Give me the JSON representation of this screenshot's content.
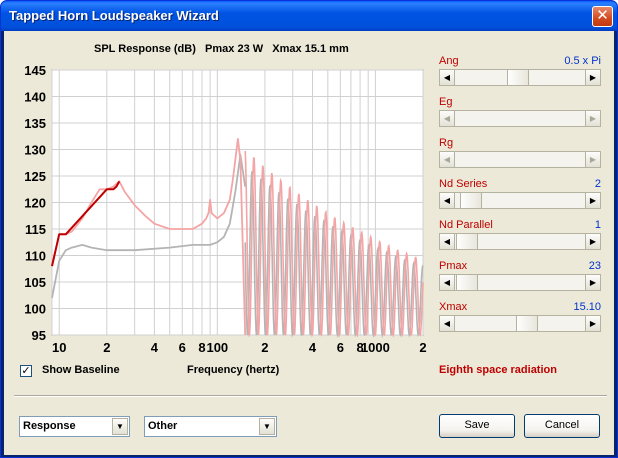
{
  "window": {
    "title": "Tapped Horn Loudspeaker Wizard",
    "close_glyph": "✕"
  },
  "chart": {
    "title": "SPL Response (dB)   Pmax 23 W   Xmax 15.1 mm"
  },
  "chart_data": {
    "type": "line",
    "title": "SPL Response (dB)   Pmax 23 W   Xmax 15.1 mm",
    "xlabel": "Frequency (hertz)",
    "ylabel": "",
    "x_scale": "log",
    "xlim": [
      9,
      2000
    ],
    "ylim": [
      95,
      145
    ],
    "grid": true,
    "x_tick_values": [
      10,
      20,
      40,
      60,
      80,
      100,
      200,
      400,
      600,
      800,
      1000,
      2000
    ],
    "x_tick_labels": [
      "10",
      "2",
      "4",
      "6",
      "8",
      "100",
      "2",
      "4",
      "6",
      "8",
      "1000",
      "2"
    ],
    "y_ticks": [
      95,
      100,
      105,
      110,
      115,
      120,
      125,
      130,
      135,
      140,
      145
    ],
    "colors": {
      "response": "#f4a4a4",
      "baseline": "#b4b4b4",
      "limited": "#c00000",
      "grid": "#d0d0d0"
    },
    "series": [
      {
        "id": "response",
        "x": [
          9,
          10,
          11,
          12,
          14,
          16,
          18,
          20,
          22,
          24,
          26,
          30,
          35,
          40,
          50,
          60,
          70,
          80,
          85,
          88,
          90,
          92,
          100,
          110,
          120,
          125,
          130,
          135,
          140,
          150
        ],
        "y": [
          108,
          114,
          114,
          114.5,
          117,
          120,
          122.5,
          122.5,
          123,
          124,
          122,
          119.5,
          117.5,
          116,
          115,
          115,
          115,
          116,
          117,
          118,
          120.5,
          118,
          117,
          118,
          120.5,
          124,
          128,
          132,
          128,
          95
        ]
      },
      {
        "id": "baseline",
        "x": [
          9,
          10,
          11,
          12,
          14,
          16,
          20,
          30,
          50,
          70,
          90,
          100,
          110,
          120,
          130,
          140,
          150
        ],
        "y": [
          102,
          109,
          111,
          111.5,
          112,
          111.5,
          111,
          111,
          111.5,
          112,
          112,
          112.5,
          113.5,
          116,
          122,
          129,
          123
        ]
      },
      {
        "id": "limited",
        "x": [
          9,
          10,
          11,
          20,
          21,
          22,
          23,
          24
        ],
        "y": [
          108,
          114,
          114,
          122.5,
          122.5,
          122.5,
          123,
          124
        ]
      }
    ]
  },
  "controls": [
    {
      "label": "Ang",
      "value": "0.5 x Pi",
      "position": 0.48,
      "disabled": false
    },
    {
      "label": "Eg",
      "value": "",
      "position": null,
      "disabled": true
    },
    {
      "label": "Rg",
      "value": "",
      "position": null,
      "disabled": true
    },
    {
      "label": "Nd  Series",
      "value": "2",
      "position": 0.04,
      "disabled": false
    },
    {
      "label": "Nd  Parallel",
      "value": "1",
      "position": 0.0,
      "disabled": false
    },
    {
      "label": "Pmax",
      "value": "23",
      "position": 0.0,
      "disabled": false
    },
    {
      "label": "Xmax",
      "value": "15.10",
      "position": 0.57,
      "disabled": false
    }
  ],
  "show_baseline": {
    "checked": true,
    "label": "Show Baseline",
    "check_glyph": "✓"
  },
  "axis_x_label": "Frequency (hertz)",
  "radiation_label": "Eighth space radiation",
  "selects": {
    "view": "Response",
    "other": "Other"
  },
  "buttons": {
    "save": "Save",
    "cancel": "Cancel"
  },
  "arrows": {
    "left": "◀",
    "right": "▶",
    "down": "▼"
  }
}
